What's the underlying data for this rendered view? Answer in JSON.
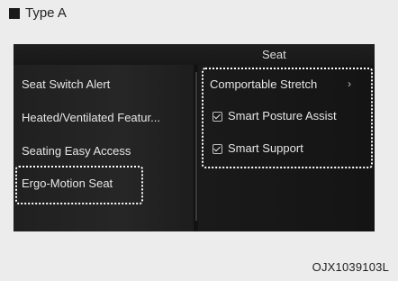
{
  "figure": {
    "type_label": "Type A",
    "caption": "OJX1039103L"
  },
  "screen": {
    "header_title": "Seat",
    "menu_items": [
      "Seat Switch Alert",
      "Heated/Ventilated Featur...",
      "Seating Easy Access",
      "Ergo-Motion Seat"
    ],
    "submenu": {
      "stretch_label": "Comportable Stretch",
      "posture_label": "Smart Posture Assist",
      "support_label": "Smart Support"
    }
  },
  "icons": {
    "checkbox": "checkbox-checked-icon",
    "chevron": "chevron-right-icon"
  }
}
